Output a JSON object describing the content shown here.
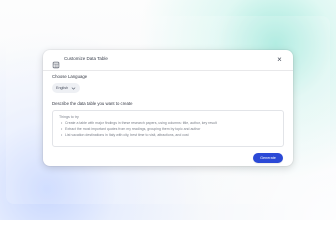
{
  "dialog": {
    "title": "Customize Data Table",
    "close_label": "×"
  },
  "language": {
    "label": "Choose Language",
    "value": "English"
  },
  "description": {
    "label": "Describe the data table you want to create",
    "heading": "Things to try",
    "items": [
      "Create a table with major findings in these research papers, using columns: title, author, key result",
      "Extract the most important quotes from my readings, grouping them by topic and author",
      "List vacation destinations in Italy with city, best time to visit, attractions, and cost"
    ]
  },
  "actions": {
    "generate_label": "Generate"
  },
  "colors": {
    "accent": "#2b49d6",
    "dialog_background": "#ffffff",
    "select_background": "#eef0f4"
  },
  "icons": {
    "title": "table-icon",
    "close": "close-icon",
    "select_chevron": "chevron-down-icon"
  }
}
